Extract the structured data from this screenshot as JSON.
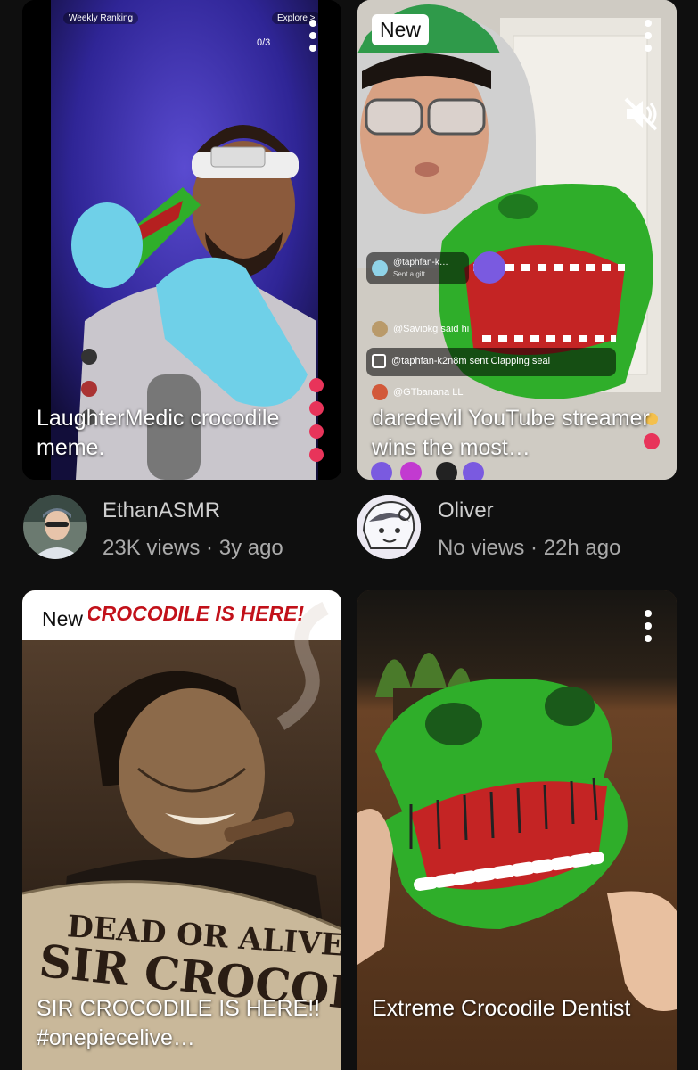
{
  "cards": [
    {
      "title": "LaughterMedic crocodile meme.",
      "channel": "EthanASMR",
      "views": "23K views",
      "age": "3y ago",
      "stats_sep": " · ",
      "overlay": {
        "weekly_ranking": "Weekly Ranking",
        "explore": "Explore >",
        "count": "0/3"
      }
    },
    {
      "badge": "New",
      "title": "daredevil YouTube streamer wins the most…",
      "channel": "Oliver",
      "views": "No views",
      "age": "22h ago",
      "stats_sep": " · ",
      "overlay": {
        "gift_user": "@taphfan-k…",
        "gift_text": "Sent a gift",
        "chat1": "@Saviokg  said hi",
        "chat2": "@taphfan-k2n8m sent Clapping seal",
        "chat3": "@GTbanana  LL"
      }
    },
    {
      "badge": "New",
      "banner": "CROCODILE IS HERE!",
      "poster_line1": "DEAD OR ALIVE",
      "poster_line2": "SIR CROCODILE",
      "title": "SIR CROCODILE IS HERE!! #onepiecelive…"
    },
    {
      "title": "Extreme Crocodile Dentist"
    }
  ],
  "icons": {
    "more": "more-vert-icon",
    "mute": "volume-off-icon"
  },
  "colors": {
    "background": "#0f0f0f",
    "channel_text": "#cfcfcf",
    "stats_text": "#aaaaaa",
    "crocodile_green": "#2fae2a"
  }
}
